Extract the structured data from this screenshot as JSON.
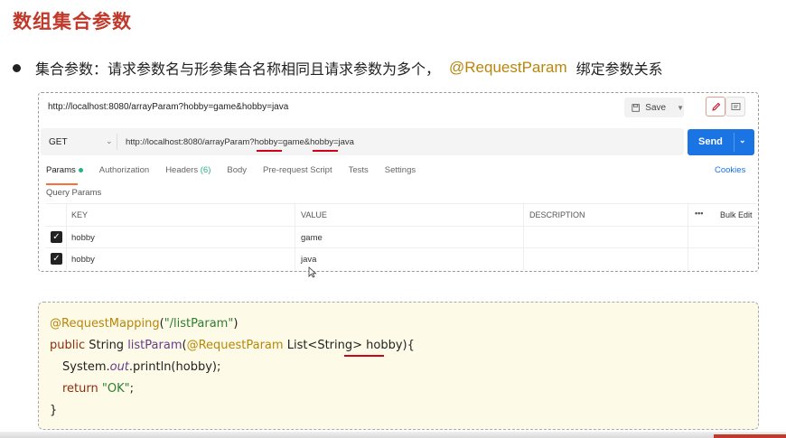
{
  "slide": {
    "title": "数组集合参数",
    "bullet": {
      "text": "集合参数：请求参数名与形参集合名称相同且请求参数为多个，",
      "highlight": "@RequestParam",
      "tail": "绑定参数关系"
    }
  },
  "postman": {
    "tab_title": "http://localhost:8080/arrayParam?hobby=game&hobby=java",
    "save_label": "Save",
    "method": "GET",
    "url": "http://localhost:8080/arrayParam?hobby=game&hobby=java",
    "send_label": "Send",
    "tabs": [
      {
        "label": "Params"
      },
      {
        "label": "Authorization"
      },
      {
        "label": "Headers",
        "count": "(6)"
      },
      {
        "label": "Body"
      },
      {
        "label": "Pre-request Script"
      },
      {
        "label": "Tests"
      },
      {
        "label": "Settings"
      }
    ],
    "cookies_label": "Cookies",
    "query_params_label": "Query Params",
    "columns": {
      "key": "KEY",
      "value": "VALUE",
      "description": "DESCRIPTION",
      "more": "•••",
      "bulk_edit": "Bulk Edit"
    },
    "rows": [
      {
        "key": "hobby",
        "value": "game",
        "description": "",
        "checked": true
      },
      {
        "key": "hobby",
        "value": "java",
        "description": "",
        "checked": true
      }
    ]
  },
  "code": {
    "line1_anno": "@RequestMapping",
    "line1_paren_open": "(",
    "line1_str": "\"/listParam\"",
    "line1_paren_close": ")",
    "line2_kw": "public",
    "line2_type": " String ",
    "line2_fn": "listParam",
    "line2_open": "(",
    "line2_anno": "@RequestParam",
    "line2_param_type": " List<String> ",
    "line2_param": "hobby",
    "line2_close": "){",
    "line3_obj": "System.",
    "line3_out": "out",
    "line3_call": ".println(hobby);",
    "line4_kw": "return",
    "line4_space": " ",
    "line4_str": "\"OK\"",
    "line4_semi": ";",
    "line5": "}"
  },
  "colors": {
    "title": "#c0392b",
    "highlight": "#b8860b",
    "send_button": "#1b74e4",
    "active_tab_underline": "#ff6c37",
    "underline_marks": "#d0021b"
  }
}
